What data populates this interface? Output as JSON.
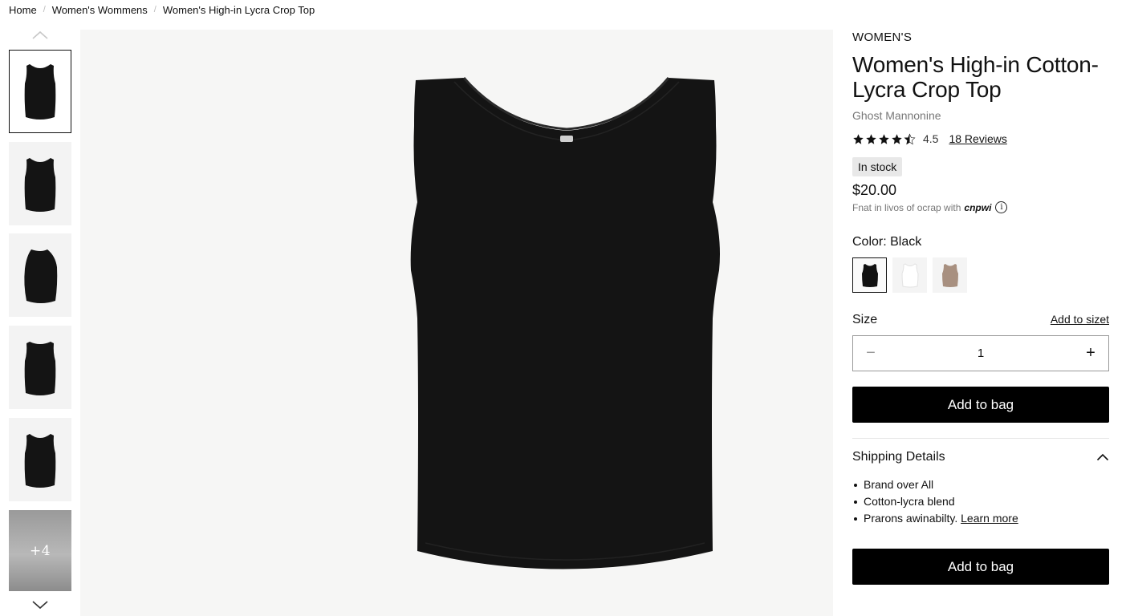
{
  "breadcrumb": {
    "items": [
      "Home",
      "Women's Wommens",
      "Women's High-in Lycra Crop Top"
    ],
    "separator": "/"
  },
  "gallery": {
    "thumbnails": [
      {
        "view": "front",
        "selected": true
      },
      {
        "view": "front"
      },
      {
        "view": "side"
      },
      {
        "view": "back"
      },
      {
        "view": "front-alt"
      }
    ],
    "more_label": "+4",
    "up_icon": "chevron-up-icon",
    "down_icon": "chevron-down-icon"
  },
  "product": {
    "brand": "WOMEN'S",
    "title": "Women's High-in Cotton-Lycra Crop Top",
    "subtitle": "Ghost Mannonine",
    "rating": {
      "value": 4.5,
      "display": "4.5",
      "max": 5,
      "reviews_label": "18 Reviews"
    },
    "stock_label": "In stock",
    "price": "$20.00",
    "pay_note": "Fnat in livos of ocrap with",
    "pay_brand": "cnpwi",
    "info_glyph": "i"
  },
  "color": {
    "label": "Color: Black",
    "swatches": [
      {
        "name": "Black",
        "hex": "#111111",
        "selected": true
      },
      {
        "name": "White",
        "hex": "#f7f7f7"
      },
      {
        "name": "Taupe",
        "hex": "#a89080"
      }
    ]
  },
  "size": {
    "label": "Size",
    "link_label": "Add to sizet",
    "quantity": "1",
    "minus_glyph": "−",
    "plus_glyph": "+"
  },
  "actions": {
    "add_to_bag_label": "Add to bag",
    "add_to_bag_label_2": "Add to bag"
  },
  "shipping": {
    "title": "Shipping Details",
    "items": [
      "Brand over All",
      "Cotton-lycra blend",
      "Prarons awinabilty."
    ],
    "learn_more": "Learn more"
  },
  "colors": {
    "product": "#141414",
    "image_bg": "#f6f6f5",
    "button_bg": "#000000",
    "button_text": "#ffffff",
    "stock_bg": "#e8e8e8"
  }
}
